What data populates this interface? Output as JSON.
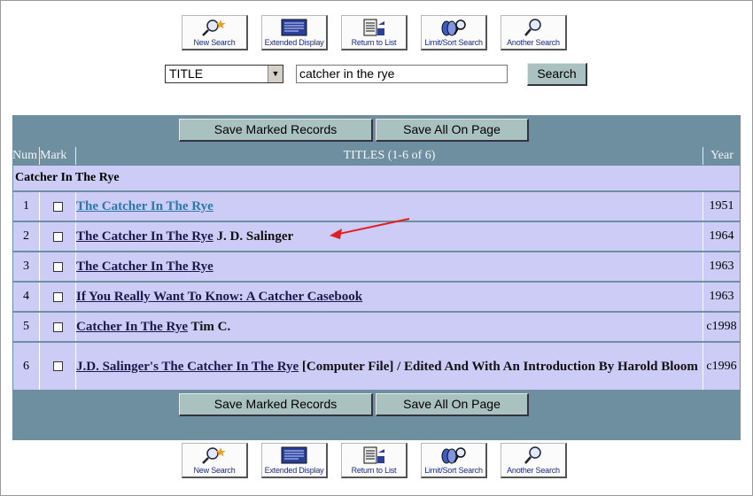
{
  "toolbar": {
    "buttons": [
      {
        "label": "New Search",
        "icon": "magnifier-sparkle-icon"
      },
      {
        "label": "Extended Display",
        "icon": "display-icon"
      },
      {
        "label": "Return to List",
        "icon": "list-icon"
      },
      {
        "label": "Limit/Sort Search",
        "icon": "limit-sort-icon"
      },
      {
        "label": "Another Search",
        "icon": "magnifier-icon"
      }
    ]
  },
  "search": {
    "field_selected": "TITLE",
    "query": "catcher in the rye",
    "button_label": "Search"
  },
  "results": {
    "save_marked_label": "Save Marked Records",
    "save_all_label": "Save All On Page",
    "headers": {
      "num": "Num",
      "mark": "Mark",
      "titles": "TITLES (1-6 of 6)",
      "year": "Year"
    },
    "group_heading": "Catcher In The Rye",
    "rows": [
      {
        "num": "1",
        "title": "The Catcher In The Rye",
        "extra": "",
        "year": "1951"
      },
      {
        "num": "2",
        "title": "The Catcher In The Rye",
        "extra": " J. D. Salinger",
        "year": "1964"
      },
      {
        "num": "3",
        "title": "The Catcher In The Rye",
        "extra": "",
        "year": "1963"
      },
      {
        "num": "4",
        "title": "If You Really Want To Know: A Catcher Casebook",
        "extra": "",
        "year": "1963"
      },
      {
        "num": "5",
        "title": "Catcher In The Rye",
        "extra": " Tim C.",
        "year": "c1998"
      },
      {
        "num": "6",
        "title": "J.D. Salinger's The Catcher In The Rye",
        "extra": " [Computer File] / Edited And With An Introduction By Harold Bloom",
        "year": "c1996"
      }
    ]
  },
  "colors": {
    "table_frame": "#6e8fa0",
    "row_background": "#ccccf6",
    "button_face": "#a9c1bf",
    "annotation_arrow": "#e02020",
    "visited_link": "#2a7aa8"
  }
}
